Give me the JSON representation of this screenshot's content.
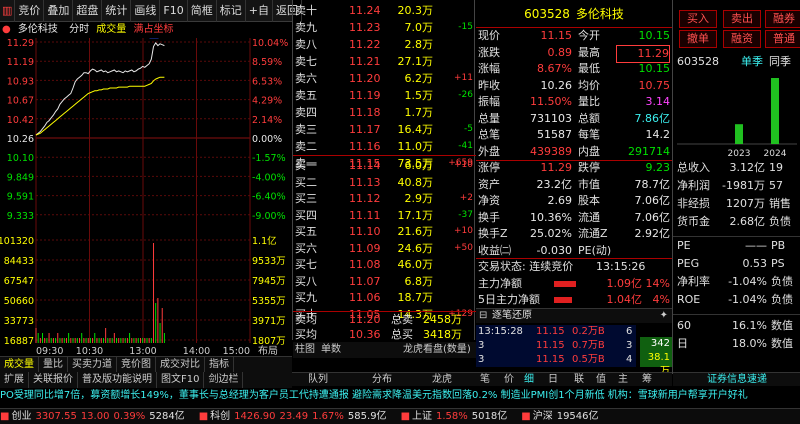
{
  "toolbar": {
    "items": [
      "",
      "竞价",
      "叠加",
      "超盘",
      "统计",
      "画线",
      "F10",
      "简框",
      "标记",
      "+自",
      "返回"
    ]
  },
  "chart_header": {
    "stock_name": "多伦科技",
    "tab_timeshare": "分时",
    "tab_volume": "成交量",
    "limit_text": "满占坐标",
    "marker": "S"
  },
  "chart": {
    "price_labels": [
      "11.29",
      "11.19",
      "10.93",
      "10.67",
      "10.42",
      "10.26",
      "10.10",
      "9.849",
      "9.591",
      "9.333",
      "101320",
      "84433",
      "67547",
      "50660",
      "33773",
      "16887"
    ],
    "pct_labels": [
      "10.04%",
      "8.59%",
      "6.53%",
      "4.29%",
      "2.14%",
      "0.00%",
      "-1.57%",
      "-4.00%",
      "-6.40%",
      "-9.00%",
      "1.1亿",
      "9533万",
      "7945万",
      "5355万",
      "3971万",
      "1807万"
    ],
    "time_labels": [
      "09:30",
      "10:30",
      "13:00",
      "14:00",
      "15:00"
    ],
    "bottom_label": "布局",
    "vol_series": [
      3,
      2,
      1,
      2,
      1,
      1,
      2,
      1,
      1,
      1,
      2,
      1,
      1,
      1,
      1,
      2,
      1,
      1,
      1,
      1,
      1,
      2,
      1,
      1,
      1,
      1,
      1,
      2,
      1,
      1,
      1,
      1,
      3,
      1,
      1,
      1,
      2,
      1,
      1,
      1,
      1,
      1,
      1,
      2,
      1,
      1,
      1,
      1,
      1,
      1,
      1,
      1,
      1,
      1,
      20,
      8,
      9,
      4,
      7,
      2
    ],
    "price_series": [
      10.26,
      10.28,
      10.3,
      10.33,
      10.36,
      10.4,
      10.42,
      10.45,
      10.48,
      10.52,
      10.55,
      10.6,
      10.63,
      10.66,
      10.68,
      10.7,
      10.72,
      10.78,
      10.85,
      10.88,
      10.9,
      10.92,
      10.95,
      10.95,
      10.94,
      10.97,
      10.99,
      10.98,
      10.96,
      10.97,
      10.98,
      10.96,
      10.97,
      10.95,
      10.96,
      10.97,
      10.98,
      10.96,
      10.97,
      10.96,
      10.95,
      10.97,
      10.96,
      10.97,
      10.98,
      10.96,
      10.97,
      10.99,
      11.0,
      11.02,
      11.01,
      11.03,
      11.05,
      11.1,
      11.24,
      11.28,
      11.25,
      11.27,
      11.26,
      11.25
    ],
    "avg_series": [
      10.26,
      10.27,
      10.28,
      10.3,
      10.32,
      10.34,
      10.36,
      10.38,
      10.4,
      10.42,
      10.44,
      10.46,
      10.48,
      10.5,
      10.52,
      10.54,
      10.56,
      10.58,
      10.6,
      10.62,
      10.64,
      10.66,
      10.68,
      10.7,
      10.72,
      10.73,
      10.74,
      10.75,
      10.75,
      10.76,
      10.76,
      10.77,
      10.77,
      10.77,
      10.78,
      10.78,
      10.78,
      10.78,
      10.79,
      10.79,
      10.79,
      10.79,
      10.79,
      10.8,
      10.8,
      10.8,
      10.8,
      10.8,
      10.8,
      10.8,
      10.8,
      10.81,
      10.82,
      10.83,
      10.86,
      10.88,
      10.89,
      10.9,
      10.9,
      10.9
    ]
  },
  "chart_tabs": {
    "row1": [
      "成交量",
      "量比",
      "买卖力道",
      "竞价图",
      "成交对比",
      "指标"
    ],
    "row2": [
      "扩展",
      "关联报价",
      "普及版功能说明",
      "图文F10",
      "剑边栏"
    ]
  },
  "orderbook": {
    "sells": [
      [
        "卖十",
        "11.24",
        "20.3万",
        ""
      ],
      [
        "卖九",
        "11.23",
        "7.0万",
        "-15"
      ],
      [
        "卖八",
        "11.22",
        "2.8万",
        ""
      ],
      [
        "卖七",
        "11.21",
        "27.1万",
        ""
      ],
      [
        "卖六",
        "11.20",
        "6.2万",
        "+11"
      ],
      [
        "卖五",
        "11.19",
        "1.5万",
        "-26"
      ],
      [
        "卖四",
        "11.18",
        "1.7万",
        ""
      ],
      [
        "卖三",
        "11.17",
        "16.4万",
        "-5"
      ],
      [
        "卖二",
        "11.16",
        "11.0万",
        "-41"
      ],
      [
        "卖一",
        "11.15",
        "73.5万",
        "+659"
      ]
    ],
    "buys": [
      [
        "买一",
        "11.14",
        "6.0万",
        "+10"
      ],
      [
        "买二",
        "11.13",
        "40.8万",
        ""
      ],
      [
        "买三",
        "11.12",
        "2.9万",
        "+2"
      ],
      [
        "买四",
        "11.11",
        "17.1万",
        "-37"
      ],
      [
        "买五",
        "11.10",
        "21.6万",
        "+10"
      ],
      [
        "买六",
        "11.09",
        "24.6万",
        "+50"
      ],
      [
        "买七",
        "11.08",
        "46.0万",
        ""
      ],
      [
        "买八",
        "11.07",
        "6.8万",
        ""
      ],
      [
        "买九",
        "11.06",
        "18.7万",
        ""
      ],
      [
        "买十",
        "11.05",
        "14.3万",
        "+129"
      ]
    ],
    "avg_sell": {
      "label": "卖均",
      "price": "11.20",
      "total_label": "总卖",
      "total": "2458万"
    },
    "avg_buy": {
      "label": "买均",
      "price": "10.36",
      "total_label": "总买",
      "total": "3418万"
    },
    "tabs": [
      "柱图",
      "单数",
      "龙虎看盘(数量)"
    ]
  },
  "quote": {
    "code": "603528",
    "name": "多伦科技",
    "rows": [
      [
        "现价",
        "11.15",
        "今开",
        "10.15"
      ],
      [
        "涨跌",
        "0.89",
        "最高",
        "11.29"
      ],
      [
        "涨幅",
        "8.67%",
        "最低",
        "10.15"
      ],
      [
        "昨收",
        "10.26",
        "均价",
        "10.75"
      ],
      [
        "振幅",
        "11.50%",
        "量比",
        "3.14"
      ],
      [
        "总量",
        "731103",
        "总额",
        "7.86亿"
      ],
      [
        "总笔",
        "51587",
        "每笔",
        "14.2"
      ],
      [
        "外盘",
        "439389",
        "内盘",
        "291714"
      ]
    ],
    "rows2": [
      [
        "涨停",
        "11.29",
        "跌停",
        "9.23"
      ],
      [
        "资产",
        "23.2亿",
        "市值",
        "78.7亿"
      ],
      [
        "净资",
        "2.69",
        "股本",
        "7.06亿"
      ],
      [
        "换手",
        "10.36%",
        "流通",
        "7.06亿"
      ],
      [
        "换手Z",
        "25.02%",
        "流通Z",
        "2.92亿"
      ],
      [
        "收益㈡",
        "-0.030",
        "PE(动)",
        ""
      ]
    ],
    "status": "交易状态: 连续竞价",
    "time": "13:15:26",
    "main_flow": {
      "label": "主力净额",
      "value": "1.09亿",
      "pct": "14%"
    },
    "main_flow5": {
      "label": "5日主力净额",
      "value": "1.04亿",
      "pct": "4%"
    },
    "ticks_title": "逐笔还原",
    "ticks": [
      [
        "13:15:28",
        "11.15",
        "0.2万B",
        "6"
      ],
      [
        "3",
        "11.15",
        "0.7万B",
        "3"
      ],
      [
        "3",
        "11.15",
        "0.5万B",
        "4"
      ]
    ],
    "tick_side": [
      "342",
      "38.1万"
    ],
    "bottom_tabs": [
      "队列",
      "分布",
      "龙虎",
      "笔",
      "价",
      "细",
      "日",
      "联",
      "值",
      "主",
      "筹"
    ]
  },
  "right": {
    "buttons": [
      "买入",
      "卖出",
      "撤单",
      "融资",
      "融券",
      "普通"
    ],
    "code": "603528",
    "label1": "单季",
    "label2": "同季",
    "bars": [
      {
        "year": "2023",
        "value": 0.3
      },
      {
        "year": "2024",
        "value": 1.0
      }
    ],
    "fin": [
      [
        "总收入",
        "3.12亿",
        "19"
      ],
      [
        "净利润",
        "-1981万",
        "57"
      ],
      [
        "非经损",
        "1207万",
        "销售"
      ],
      [
        "货币金",
        "2.68亿",
        "负债"
      ]
    ],
    "pe": [
      [
        "PE",
        "——",
        "PB"
      ],
      [
        "PEG",
        "0.53",
        "PS"
      ],
      [
        "净利率",
        "-1.04%",
        "负债"
      ],
      [
        "ROE",
        "-1.04%",
        "负债"
      ]
    ],
    "extra": [
      [
        "60",
        "16.1%",
        "数值"
      ],
      [
        "日",
        "18.0%",
        "数值"
      ]
    ],
    "bottom": "证券信息速递"
  },
  "news": "PO受理同比增7倍，募资额增长149%，董事长与总经理为客户员工代持遭通报    避险需求降温美元指数回落0.2% 制造业PMI创1个月新低    机构：雪球新用户帮享开户好礼",
  "index": [
    [
      "创业",
      "3307.55",
      "13.00",
      "0.39%",
      "5284亿"
    ],
    [
      "科创",
      "1426.90",
      "23.49",
      "1.67%",
      "585.9亿"
    ],
    [
      "上证",
      "",
      "",
      "1.58%",
      "5018亿"
    ],
    [
      "沪深",
      "",
      "",
      "",
      "19546亿"
    ]
  ],
  "colors": {
    "red": "#ff3c3c",
    "green": "#00e000",
    "yellow": "#ffff00",
    "white": "#e8e8e8",
    "cyan": "#3cf0f0",
    "magenta": "#ff44ff"
  }
}
